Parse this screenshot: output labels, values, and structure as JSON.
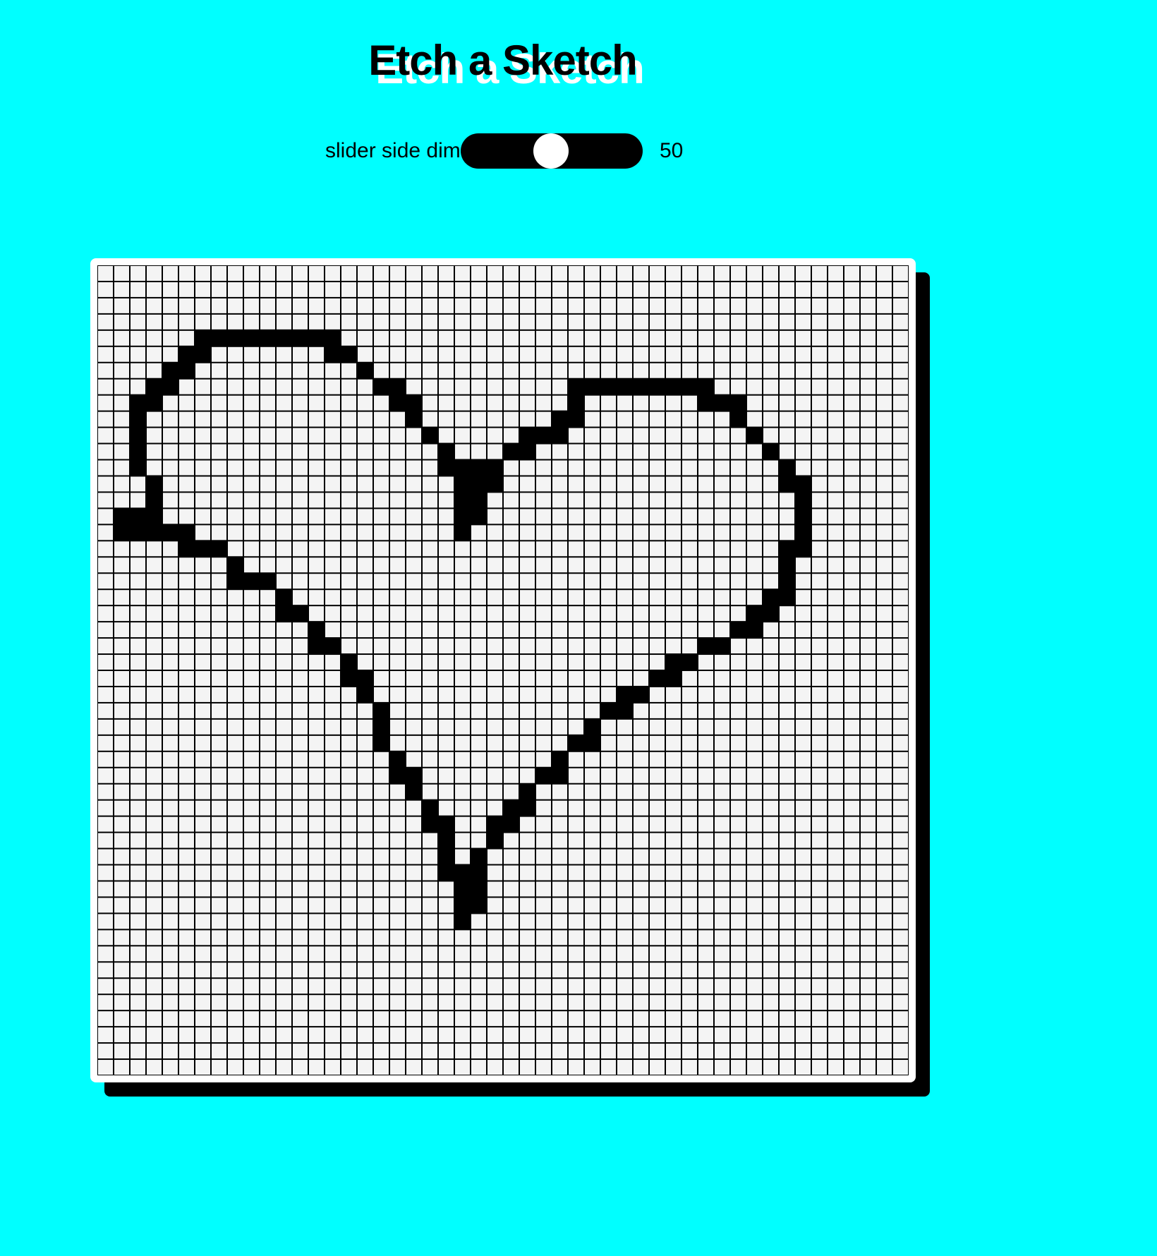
{
  "title": "Etch a Sketch",
  "slider": {
    "label": "slider side dim",
    "value": 50,
    "value_text": "50",
    "min": 1,
    "max": 100
  },
  "colors": {
    "background": "#00ffff",
    "ink": "#000000",
    "cell": "#f4f4f4",
    "frame": "#ffffff"
  },
  "grid": {
    "side": 50,
    "filled_rows": [
      [
        4,
        [
          6,
          14
        ]
      ],
      [
        5,
        [
          5,
          6
        ],
        [
          14,
          15
        ]
      ],
      [
        6,
        [
          4,
          5
        ],
        [
          16
        ]
      ],
      [
        7,
        [
          3,
          4
        ],
        [
          17,
          18
        ],
        [
          29,
          37
        ]
      ],
      [
        8,
        [
          2,
          3
        ],
        [
          18,
          19
        ],
        [
          29
        ],
        [
          37,
          39
        ]
      ],
      [
        9,
        [
          2
        ],
        [
          19
        ],
        [
          28,
          29
        ],
        [
          39
        ]
      ],
      [
        10,
        [
          2
        ],
        [
          20
        ],
        [
          26,
          28
        ],
        [
          40
        ]
      ],
      [
        11,
        [
          2
        ],
        [
          21
        ],
        [
          25,
          26
        ],
        [
          41
        ]
      ],
      [
        12,
        [
          2
        ],
        [
          21,
          24
        ],
        [
          42
        ]
      ],
      [
        13,
        [
          3
        ],
        [
          22,
          24
        ],
        [
          42,
          43
        ]
      ],
      [
        14,
        [
          3
        ],
        [
          22,
          23
        ],
        [
          43
        ]
      ],
      [
        15,
        [
          1,
          3
        ],
        [
          22,
          23
        ],
        [
          43
        ]
      ],
      [
        16,
        [
          1,
          5
        ],
        [
          22
        ],
        [
          43
        ]
      ],
      [
        17,
        [
          5,
          7
        ],
        [
          42,
          43
        ]
      ],
      [
        18,
        [
          8
        ],
        [
          42
        ]
      ],
      [
        19,
        [
          8,
          10
        ],
        [
          42
        ]
      ],
      [
        20,
        [
          11
        ],
        [
          41,
          42
        ]
      ],
      [
        21,
        [
          11,
          12
        ],
        [
          40,
          41
        ]
      ],
      [
        22,
        [
          13
        ],
        [
          39,
          40
        ]
      ],
      [
        23,
        [
          13,
          14
        ],
        [
          37,
          38
        ]
      ],
      [
        24,
        [
          15
        ],
        [
          35,
          36
        ]
      ],
      [
        25,
        [
          15,
          16
        ],
        [
          34,
          35
        ]
      ],
      [
        26,
        [
          16
        ],
        [
          32,
          33
        ]
      ],
      [
        27,
        [
          17
        ],
        [
          31,
          32
        ]
      ],
      [
        28,
        [
          17
        ],
        [
          30
        ]
      ],
      [
        29,
        [
          17
        ],
        [
          29,
          30
        ]
      ],
      [
        30,
        [
          18
        ],
        [
          28
        ]
      ],
      [
        31,
        [
          18,
          19
        ],
        [
          27,
          28
        ]
      ],
      [
        32,
        [
          19
        ],
        [
          26
        ]
      ],
      [
        33,
        [
          20
        ],
        [
          25,
          26
        ]
      ],
      [
        34,
        [
          20,
          21
        ],
        [
          24,
          25
        ]
      ],
      [
        35,
        [
          21
        ],
        [
          24
        ]
      ],
      [
        36,
        [
          21
        ],
        [
          23
        ]
      ],
      [
        37,
        [
          21,
          23
        ]
      ],
      [
        38,
        [
          22,
          23
        ]
      ],
      [
        39,
        [
          22,
          23
        ]
      ],
      [
        40,
        [
          22
        ]
      ]
    ]
  }
}
